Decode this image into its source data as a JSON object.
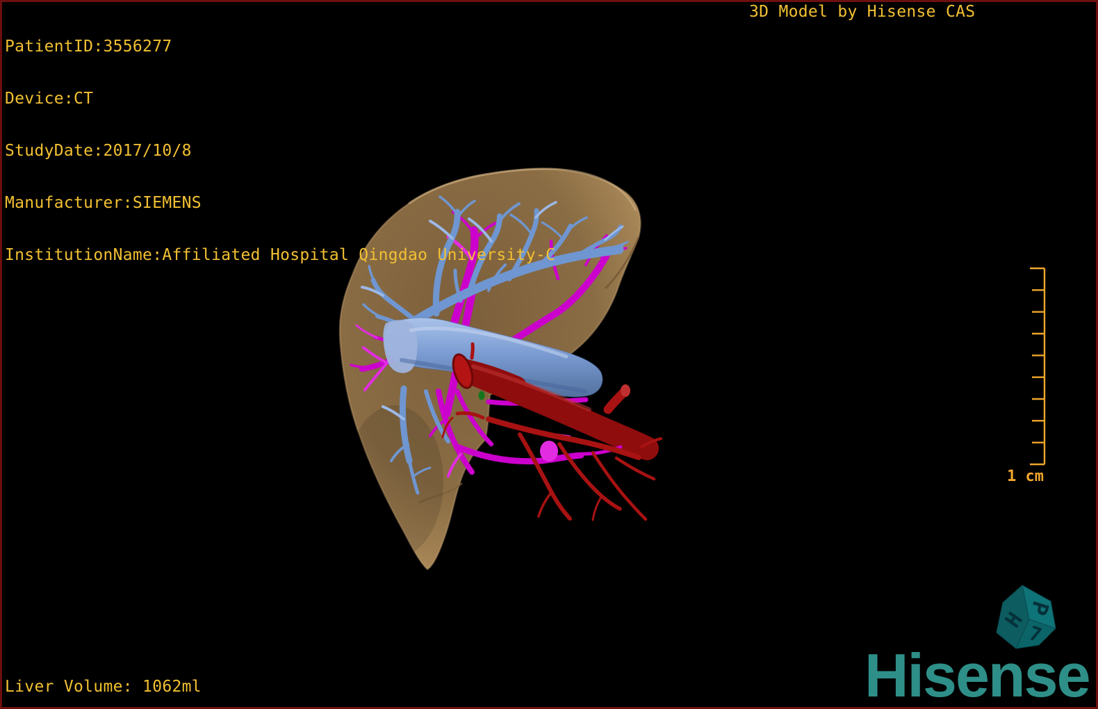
{
  "header": {
    "lines": [
      "PatientID:3556277",
      "Device:CT",
      "StudyDate:2017/10/8",
      "Manufacturer:SIEMENS",
      "InstitutionName:Affiliated Hospital Qingdao University-C"
    ]
  },
  "watermark": "3D Model by Hisense CAS",
  "footer": {
    "liver_volume": "Liver Volume: 1062ml"
  },
  "scale_bar": {
    "label": "1 cm",
    "tick_count": 10
  },
  "orientation_cube": {
    "faces": [
      "H",
      "P",
      "7"
    ]
  },
  "logo": {
    "text": "Hisense"
  },
  "colors": {
    "overlay-text": "#f2c032",
    "scale": "#f0a62c",
    "border": "#6b0f0f",
    "logo-teal": "#2e8f88",
    "cube-face-top": "#0f7478",
    "cube-face-left": "#0c5c60",
    "cube-face-bottom": "#0a6468",
    "liver": "#9a7a4e",
    "liver-edge": "#c8a878",
    "vein-blue": "#6f96d0",
    "vein-blue-light": "#9cb8e6",
    "vein-magenta": "#cc00cc",
    "vein-magenta-bright": "#e22ce2",
    "ivc-red": "#8f0d0d",
    "artery-red": "#a81212",
    "bile-green": "#15751c"
  }
}
